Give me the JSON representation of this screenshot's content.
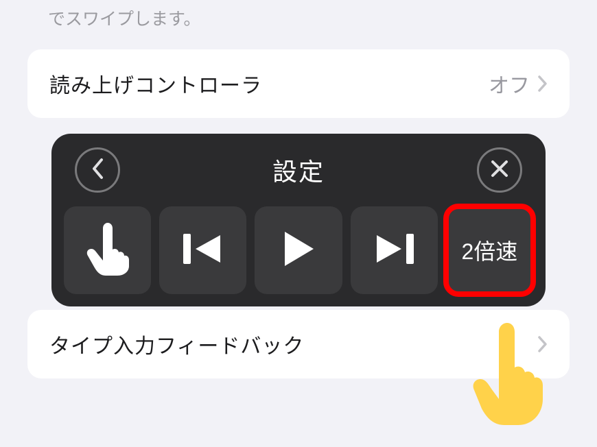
{
  "intro_text": "でスワイプします。",
  "list": {
    "item1": {
      "label": "読み上げコントローラ",
      "value": "オフ"
    },
    "item2": {
      "label": "タイプ入力フィードバック"
    }
  },
  "overlay": {
    "title": "設定",
    "speed_label": "2倍速",
    "icons": {
      "back": "back-icon",
      "close": "close-icon",
      "finger": "finger-icon",
      "prev": "prev-icon",
      "play": "play-icon",
      "next": "next-icon"
    }
  }
}
